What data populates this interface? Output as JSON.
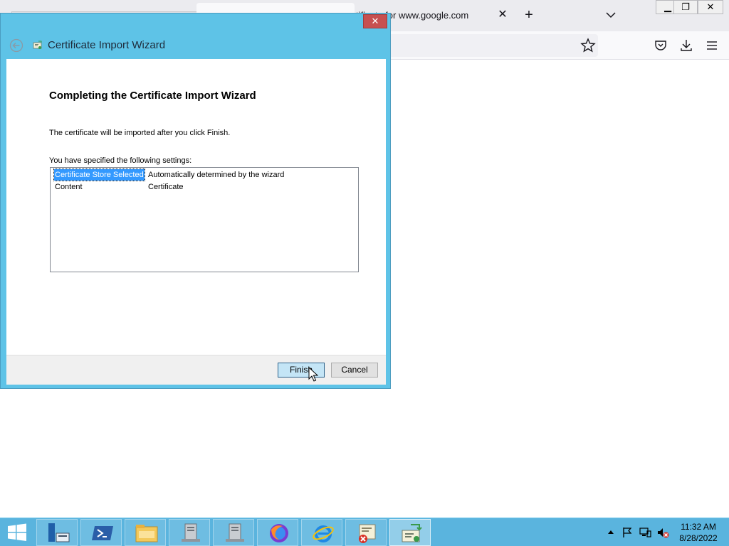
{
  "browser": {
    "tab_title": "tificate for www.google.com",
    "tab_close_glyph": "✕",
    "new_tab_glyph": "+",
    "window_controls": {
      "minimize": "▁",
      "maximize": "❐",
      "close": "✕"
    },
    "toolbar_icons": [
      "bookmark-star-icon",
      "pocket-icon",
      "downloads-icon",
      "menu-icon"
    ]
  },
  "dialog": {
    "close_glyph": "✕",
    "title": "Certificate Import Wizard",
    "heading": "Completing the Certificate Import Wizard",
    "info_text": "The certificate will be imported after you click Finish.",
    "settings_label": "You have specified the following settings:",
    "settings": [
      {
        "key": "Certificate Store Selected",
        "value": "Automatically determined by the wizard",
        "selected": true
      },
      {
        "key": "Content",
        "value": "Certificate",
        "selected": false
      }
    ],
    "finish_label": "Finish",
    "cancel_label": "Cancel"
  },
  "taskbar": {
    "apps": [
      "start-icon",
      "server-manager-icon",
      "powershell-icon",
      "file-explorer-icon",
      "server-app-icon",
      "server-app-icon",
      "firefox-icon",
      "internet-explorer-icon",
      "certificate-manager-icon",
      "certificate-import-icon"
    ],
    "clock_time": "11:32 AM",
    "clock_date": "8/28/2022"
  },
  "colors": {
    "dialog_frame": "#5ec3e7",
    "taskbar": "#5ab4de",
    "selection": "#3399ff",
    "close_button": "#c75050"
  }
}
